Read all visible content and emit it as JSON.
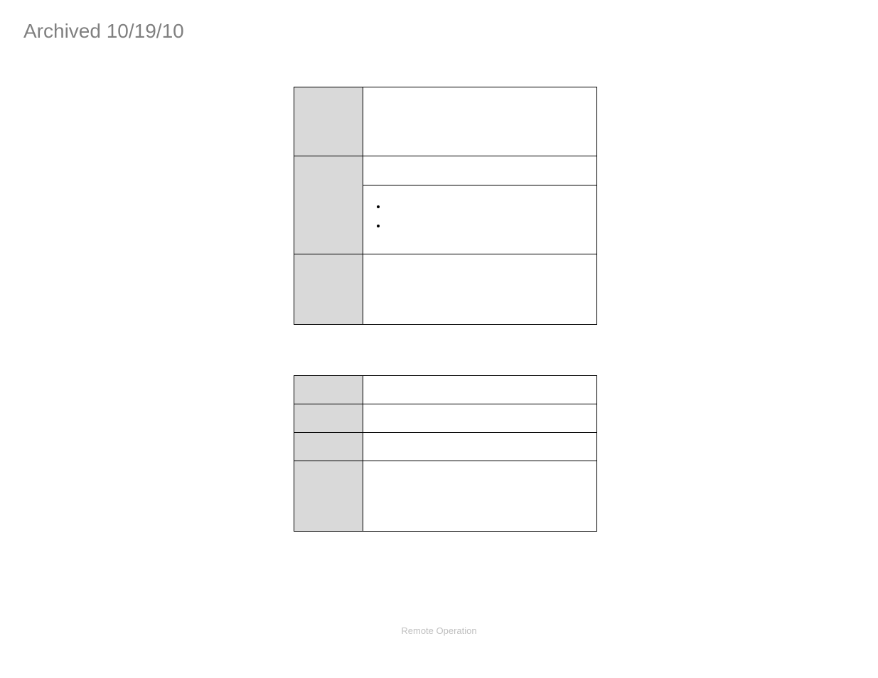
{
  "header": {
    "text": "Archived 10/19/10"
  },
  "table1": {
    "rows": [
      {
        "left": "",
        "right": ""
      },
      {
        "left": "",
        "right": ""
      },
      {
        "left": "",
        "bullets": [
          "",
          ""
        ]
      },
      {
        "left": "",
        "right": ""
      }
    ]
  },
  "table2": {
    "rows": [
      {
        "left": "",
        "right": ""
      },
      {
        "left": "",
        "right": ""
      },
      {
        "left": "",
        "right": ""
      },
      {
        "left": "",
        "right": ""
      }
    ]
  },
  "footer": {
    "text": "Remote Operation"
  }
}
